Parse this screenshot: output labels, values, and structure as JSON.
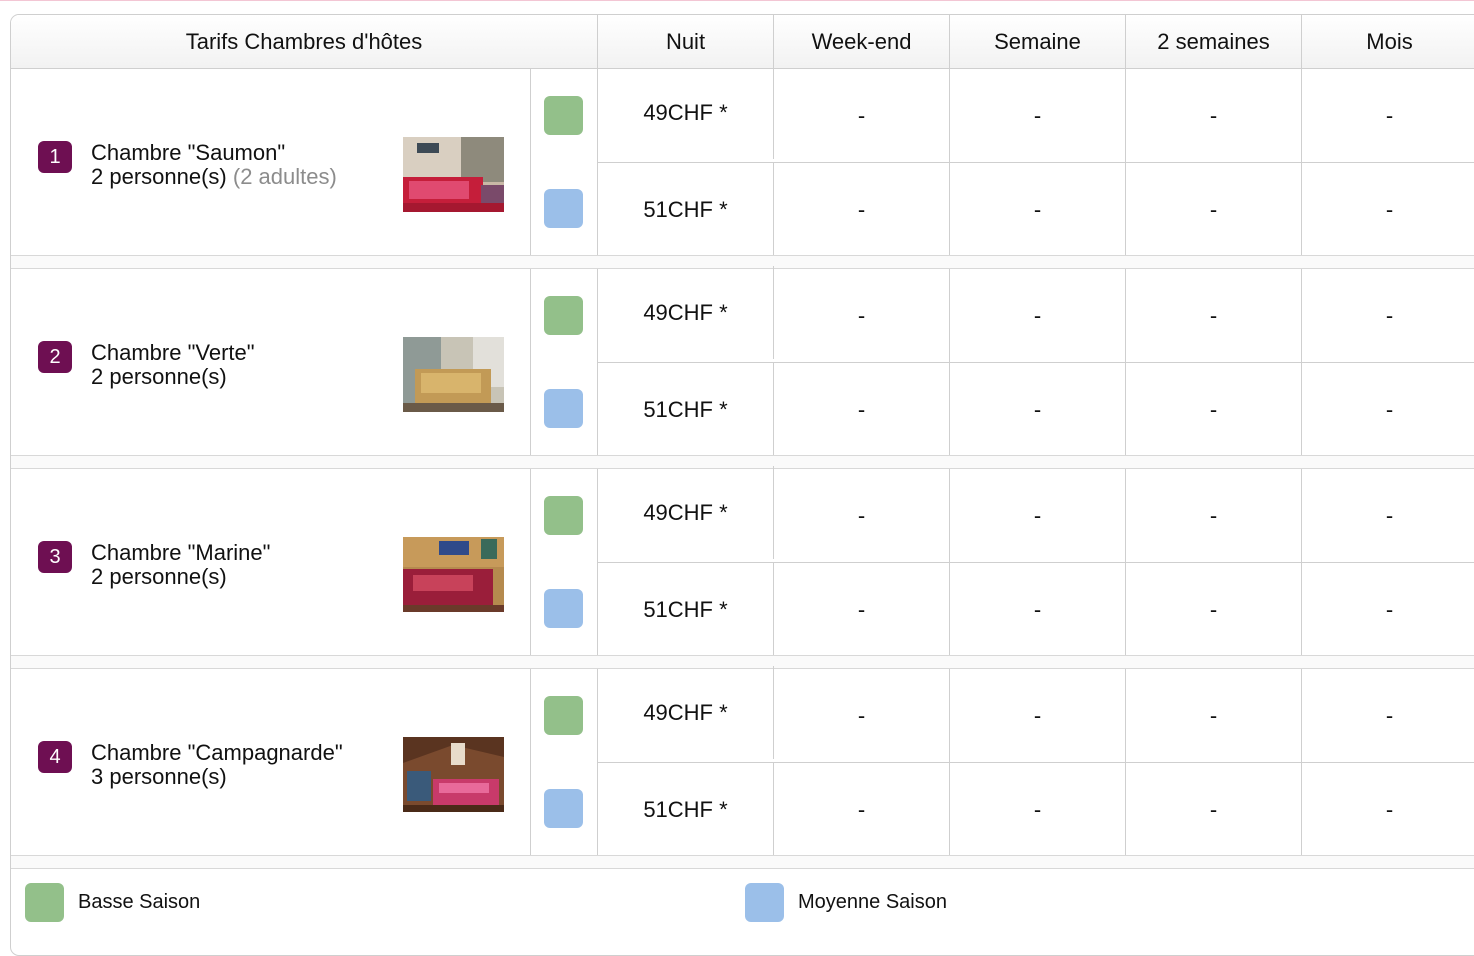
{
  "header": {
    "title": "Tarifs Chambres d'hôtes",
    "columns": [
      "Nuit",
      "Week-end",
      "Semaine",
      "2 semaines",
      "Mois"
    ]
  },
  "seasons": {
    "basse": {
      "label": "Basse Saison",
      "color": "#93c08a"
    },
    "moyenne": {
      "label": "Moyenne Saison",
      "color": "#9bbfe9"
    }
  },
  "rooms": [
    {
      "number": "1",
      "name": "Chambre \"Saumon\"",
      "capacity": "2 personne(s)",
      "extra": "(2 adultes)",
      "photo_icon": "bedroom-photo-red",
      "rates": [
        {
          "season": "basse",
          "values": [
            "49CHF *",
            "-",
            "-",
            "-",
            "-"
          ]
        },
        {
          "season": "moyenne",
          "values": [
            "51CHF *",
            "-",
            "-",
            "-",
            "-"
          ]
        }
      ]
    },
    {
      "number": "2",
      "name": "Chambre \"Verte\"",
      "capacity": "2 personne(s)",
      "extra": "",
      "photo_icon": "bedroom-photo-gold",
      "rates": [
        {
          "season": "basse",
          "values": [
            "49CHF *",
            "-",
            "-",
            "-",
            "-"
          ]
        },
        {
          "season": "moyenne",
          "values": [
            "51CHF *",
            "-",
            "-",
            "-",
            "-"
          ]
        }
      ]
    },
    {
      "number": "3",
      "name": "Chambre \"Marine\"",
      "capacity": "2 personne(s)",
      "extra": "",
      "photo_icon": "bedroom-photo-marine",
      "rates": [
        {
          "season": "basse",
          "values": [
            "49CHF *",
            "-",
            "-",
            "-",
            "-"
          ]
        },
        {
          "season": "moyenne",
          "values": [
            "51CHF *",
            "-",
            "-",
            "-",
            "-"
          ]
        }
      ]
    },
    {
      "number": "4",
      "name": "Chambre \"Campagnarde\"",
      "capacity": "3 personne(s)",
      "extra": "",
      "photo_icon": "bedroom-photo-rustic",
      "rates": [
        {
          "season": "basse",
          "values": [
            "49CHF *",
            "-",
            "-",
            "-",
            "-"
          ]
        },
        {
          "season": "moyenne",
          "values": [
            "51CHF *",
            "-",
            "-",
            "-",
            "-"
          ]
        }
      ]
    }
  ],
  "legend": [
    "basse",
    "moyenne"
  ]
}
